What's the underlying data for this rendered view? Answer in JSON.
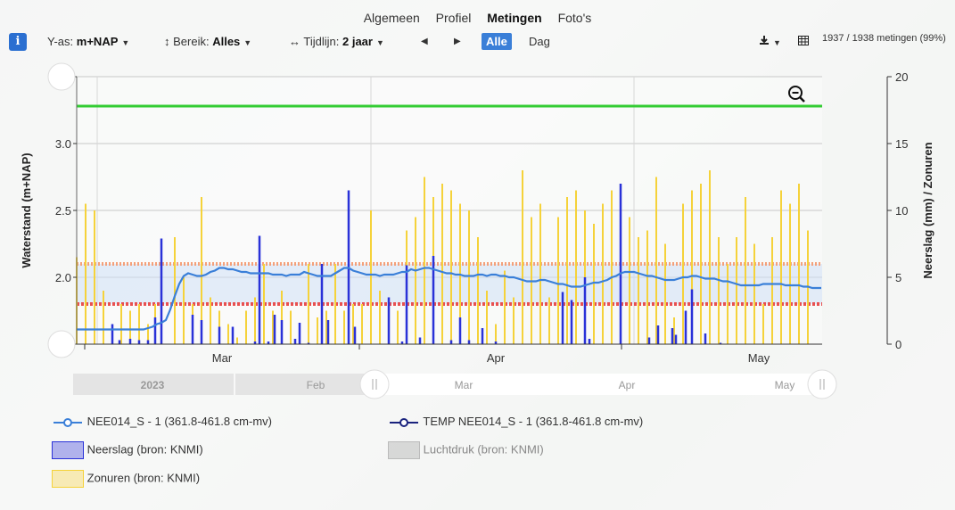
{
  "tabs": [
    {
      "label": "Algemeen",
      "active": false
    },
    {
      "label": "Profiel",
      "active": false
    },
    {
      "label": "Metingen",
      "active": true
    },
    {
      "label": "Foto's",
      "active": false
    }
  ],
  "toolbar": {
    "info_icon": "info-icon",
    "yaxis_label": "Y-as:",
    "yaxis_value": "m+NAP",
    "range_icon": "vertical-arrows-icon",
    "range_label": "Bereik:",
    "range_value": "Alles",
    "timeline_icon": "horizontal-arrows-icon",
    "timeline_label": "Tijdlijn:",
    "timeline_value": "2 jaar",
    "prev": "◀",
    "next": "▶",
    "alle": "Alle",
    "dag": "Dag",
    "download_icon": "download-icon",
    "table_icon": "table-icon",
    "count": "1937 / 1938 metingen (99%)"
  },
  "colors": {
    "water": "#3a7fd8",
    "temp": "#1a237e",
    "rain": "#2a32d8",
    "sun": "#f5d23a",
    "pressure": "#9c9c9c",
    "green": "#33cc33",
    "orange": "#f4a07a",
    "red": "#e85050",
    "band": "#cfe0f5"
  },
  "navigator": {
    "labels": [
      "2023",
      "Feb",
      "Mar",
      "Apr",
      "May"
    ]
  },
  "chart_data": {
    "type": "line",
    "ylabel_left": "Waterstand (m+NAP)",
    "ylabel_right": "Neerslag (mm) / Zonuren",
    "ylim_left": [
      1.5,
      3.5
    ],
    "ylim_right": [
      0,
      20
    ],
    "yticks_left": [
      "1.5",
      "2.0",
      "2.5",
      "3.0",
      "3.5"
    ],
    "yticks_right": [
      "0",
      "5",
      "10",
      "15",
      "20"
    ],
    "xticks": [
      "Mar",
      "Apr",
      "May"
    ],
    "grid": true,
    "reference_lines": [
      {
        "value": 3.28,
        "color": "green"
      },
      {
        "value": 2.1,
        "color": "orange"
      },
      {
        "value": 1.8,
        "color": "red"
      }
    ],
    "band": [
      1.8,
      2.1
    ],
    "series": [
      {
        "name": "NEE014_S - 1 (361.8-461.8 cm-mv)",
        "axis": "left",
        "x": [
          0,
          5,
          10,
          15,
          20,
          25,
          30,
          35,
          40,
          45,
          50,
          55,
          60,
          65,
          70,
          75,
          80,
          85,
          90,
          95,
          100,
          105,
          110,
          115,
          120,
          125,
          130,
          135,
          140,
          145,
          150,
          155,
          160,
          165,
          170,
          175,
          180,
          185,
          190,
          195,
          200,
          205,
          210,
          215,
          220,
          225,
          230,
          235,
          240,
          245,
          250,
          255,
          260,
          265,
          270,
          275,
          280,
          285,
          290,
          295,
          300,
          305,
          310,
          315,
          320,
          325,
          330,
          335,
          340,
          345,
          350,
          355,
          360,
          365,
          370,
          375,
          380,
          385,
          390,
          395,
          400,
          405,
          410,
          415,
          420,
          425,
          430,
          435,
          440,
          445,
          450,
          455,
          460,
          465,
          470,
          475,
          480,
          485,
          490,
          495,
          500,
          505,
          510,
          515,
          520,
          525,
          530,
          535,
          540,
          545,
          550,
          555,
          560,
          565,
          570,
          575,
          580,
          585,
          590,
          595,
          600,
          605,
          610,
          615,
          620,
          625,
          630,
          635,
          640,
          645,
          650,
          655,
          660,
          665,
          670,
          675,
          680,
          685,
          690,
          695,
          700,
          705,
          710,
          715,
          720,
          725,
          730,
          735,
          740,
          745,
          750,
          755,
          760,
          765,
          770,
          775,
          780,
          785,
          790,
          795,
          800,
          805,
          810,
          815,
          820,
          825,
          830,
          835
        ],
        "values": [
          1.61,
          1.61,
          1.61,
          1.61,
          1.61,
          1.61,
          1.61,
          1.61,
          1.61,
          1.61,
          1.61,
          1.61,
          1.61,
          1.61,
          1.61,
          1.61,
          1.62,
          1.63,
          1.65,
          1.66,
          1.68,
          1.76,
          1.86,
          1.95,
          2.01,
          2.03,
          2.02,
          2.01,
          2.01,
          2.02,
          2.04,
          2.05,
          2.07,
          2.07,
          2.06,
          2.06,
          2.05,
          2.04,
          2.04,
          2.03,
          2.03,
          2.03,
          2.03,
          2.03,
          2.02,
          2.02,
          2.02,
          2.01,
          2.02,
          2.02,
          2.02,
          2.04,
          2.03,
          2.02,
          2.01,
          2.01,
          2.01,
          2.01,
          2.03,
          2.05,
          2.07,
          2.07,
          2.05,
          2.04,
          2.03,
          2.02,
          2.02,
          2.02,
          2.01,
          2.02,
          2.02,
          2.02,
          2.03,
          2.04,
          2.04,
          2.06,
          2.05,
          2.06,
          2.07,
          2.07,
          2.06,
          2.05,
          2.04,
          2.03,
          2.03,
          2.02,
          2.02,
          2.01,
          2.01,
          2.01,
          2.02,
          2.02,
          2.01,
          2.02,
          2.02,
          2.01,
          2.01,
          2.0,
          2.0,
          1.99,
          1.98,
          1.97,
          1.97,
          1.97,
          1.98,
          1.98,
          1.97,
          1.96,
          1.95,
          1.95,
          1.94,
          1.93,
          1.93,
          1.93,
          1.94,
          1.95,
          1.96,
          1.96,
          1.97,
          1.98,
          2.0,
          2.01,
          2.03,
          2.04,
          2.04,
          2.04,
          2.03,
          2.02,
          2.01,
          2.01,
          2.0,
          1.99,
          1.98,
          1.98,
          1.98,
          1.99,
          2.0,
          2.0,
          2.01,
          2.01,
          2.0,
          1.99,
          1.99,
          1.99,
          1.98,
          1.97,
          1.97,
          1.96,
          1.95,
          1.94,
          1.94,
          1.94,
          1.94,
          1.94,
          1.95,
          1.95,
          1.95,
          1.95,
          1.95,
          1.94,
          1.94,
          1.94,
          1.94,
          1.93,
          1.93,
          1.92,
          1.92,
          1.92
        ]
      },
      {
        "name": "TEMP NEE014_S - 1 (361.8-461.8 cm-mv)",
        "axis": "left",
        "x": [],
        "values": []
      },
      {
        "name": "Neerslag (bron: KNMI)",
        "axis": "right",
        "type": "bar",
        "x": [
          40,
          48,
          60,
          70,
          80,
          88,
          95,
          130,
          140,
          160,
          175,
          200,
          205,
          215,
          222,
          230,
          245,
          250,
          260,
          275,
          282,
          305,
          312,
          350,
          365,
          370,
          385,
          400,
          420,
          430,
          440,
          455,
          470,
          545,
          555,
          570,
          575,
          610,
          642,
          652,
          668,
          672,
          683,
          690,
          705,
          722
        ],
        "values": [
          1.5,
          0.3,
          0.4,
          0.3,
          0.3,
          2.0,
          7.9,
          2.2,
          1.8,
          1.3,
          1.3,
          0.2,
          8.1,
          0.2,
          2.2,
          1.8,
          0.4,
          1.6,
          0.1,
          6.0,
          1.8,
          11.5,
          1.3,
          3.5,
          0.2,
          5.9,
          0.5,
          6.6,
          0.3,
          2.0,
          0.3,
          1.2,
          0.2,
          3.9,
          3.3,
          5.0,
          0.4,
          12.0,
          0.5,
          1.4,
          1.2,
          0.7,
          2.5,
          4.1,
          0.8,
          0.1
        ]
      },
      {
        "name": "Zonuren (bron: KNMI)",
        "axis": "right",
        "type": "bar",
        "x": [
          0,
          10,
          20,
          30,
          50,
          60,
          70,
          80,
          88,
          95,
          110,
          120,
          130,
          140,
          150,
          160,
          170,
          180,
          190,
          200,
          210,
          220,
          230,
          240,
          250,
          260,
          270,
          280,
          290,
          300,
          310,
          320,
          330,
          340,
          350,
          360,
          370,
          380,
          390,
          400,
          410,
          420,
          430,
          440,
          450,
          460,
          470,
          480,
          490,
          500,
          510,
          520,
          530,
          540,
          550,
          560,
          570,
          580,
          590,
          600,
          610,
          620,
          630,
          640,
          650,
          660,
          670,
          680,
          690,
          700,
          710,
          720,
          730,
          740,
          750,
          760,
          770,
          780,
          790,
          800,
          810,
          820
        ],
        "values": [
          6.5,
          10.5,
          10,
          4,
          3,
          2.5,
          3,
          1.5,
          3,
          5,
          8,
          5,
          3,
          11,
          3.5,
          2.5,
          1.5,
          0.5,
          2.5,
          3.5,
          6,
          2.5,
          4,
          2.5,
          1.5,
          6,
          2,
          2.5,
          6,
          2.5,
          3,
          3,
          10,
          4,
          2.5,
          2.5,
          8.5,
          9.5,
          12.5,
          11,
          12,
          11.5,
          10.5,
          10,
          8,
          4,
          1.5,
          5.5,
          3.5,
          13,
          9.5,
          10.5,
          3.5,
          9.5,
          11,
          11.5,
          10,
          9,
          10.5,
          11.5,
          5.5,
          9.5,
          8,
          8.5,
          12.5,
          7.5,
          2,
          10.5,
          11.5,
          12,
          13,
          8,
          6,
          8,
          11,
          7.5,
          3,
          8,
          11.5,
          10.5,
          12,
          8.5
        ]
      },
      {
        "name": "Luchtdruk (bron: KNMI)",
        "axis": "right",
        "type": "bar",
        "x": [],
        "values": []
      }
    ]
  },
  "legend": [
    {
      "label": "NEE014_S - 1 (361.8-461.8 cm-mv)",
      "kind": "line-circle",
      "color": "#3a7fd8"
    },
    {
      "label": "TEMP NEE014_S - 1 (361.8-461.8 cm-mv)",
      "kind": "line-circle",
      "color": "#1a237e"
    },
    {
      "label": "Neerslag (bron: KNMI)",
      "kind": "box",
      "color": "#2a32d8"
    },
    {
      "label": "Luchtdruk (bron: KNMI)",
      "kind": "box-gray",
      "color": "#9c9c9c"
    },
    {
      "label": "Zonuren (bron: KNMI)",
      "kind": "box",
      "color": "#f5d23a"
    }
  ]
}
